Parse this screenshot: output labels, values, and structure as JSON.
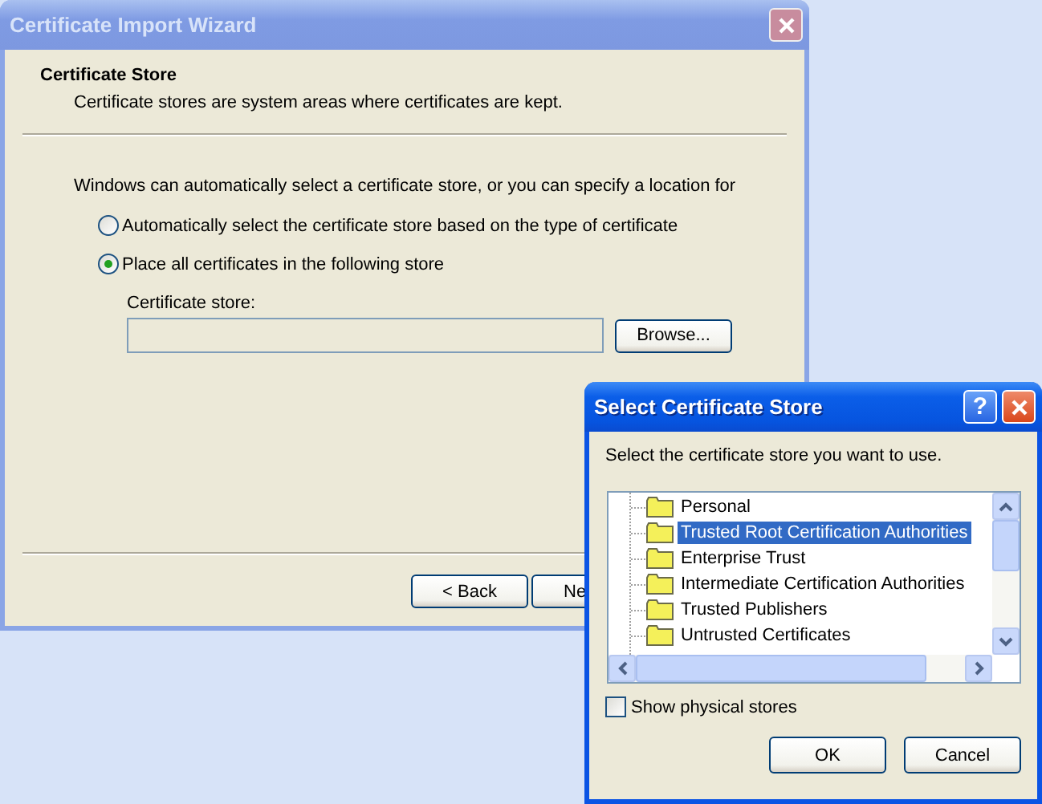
{
  "wizard": {
    "title": "Certificate Import Wizard",
    "heading": "Certificate Store",
    "subheading": "Certificate stores are system areas where certificates are kept.",
    "intro": "Windows can automatically select a certificate store, or you can specify a location for",
    "options": [
      {
        "label": "Automatically select the certificate store based on the type of certificate",
        "selected": false
      },
      {
        "label": "Place all certificates in the following store",
        "selected": true
      }
    ],
    "store_label": "Certificate store:",
    "browse_button": "Browse...",
    "buttons": [
      "< Back",
      "Ne"
    ]
  },
  "dialog": {
    "title": "Select Certificate Store",
    "help_button": "?",
    "prompt": "Select the certificate store you want to use.",
    "stores": [
      {
        "label": "Personal",
        "selected": false
      },
      {
        "label": "Trusted Root Certification Authorities",
        "selected": true
      },
      {
        "label": "Enterprise Trust",
        "selected": false
      },
      {
        "label": "Intermediate Certification Authorities",
        "selected": false
      },
      {
        "label": "Trusted Publishers",
        "selected": false
      },
      {
        "label": "Untrusted Certificates",
        "selected": false
      }
    ],
    "show_physical": {
      "label": "Show physical stores",
      "checked": false
    },
    "buttons": [
      "OK",
      "Cancel"
    ]
  }
}
